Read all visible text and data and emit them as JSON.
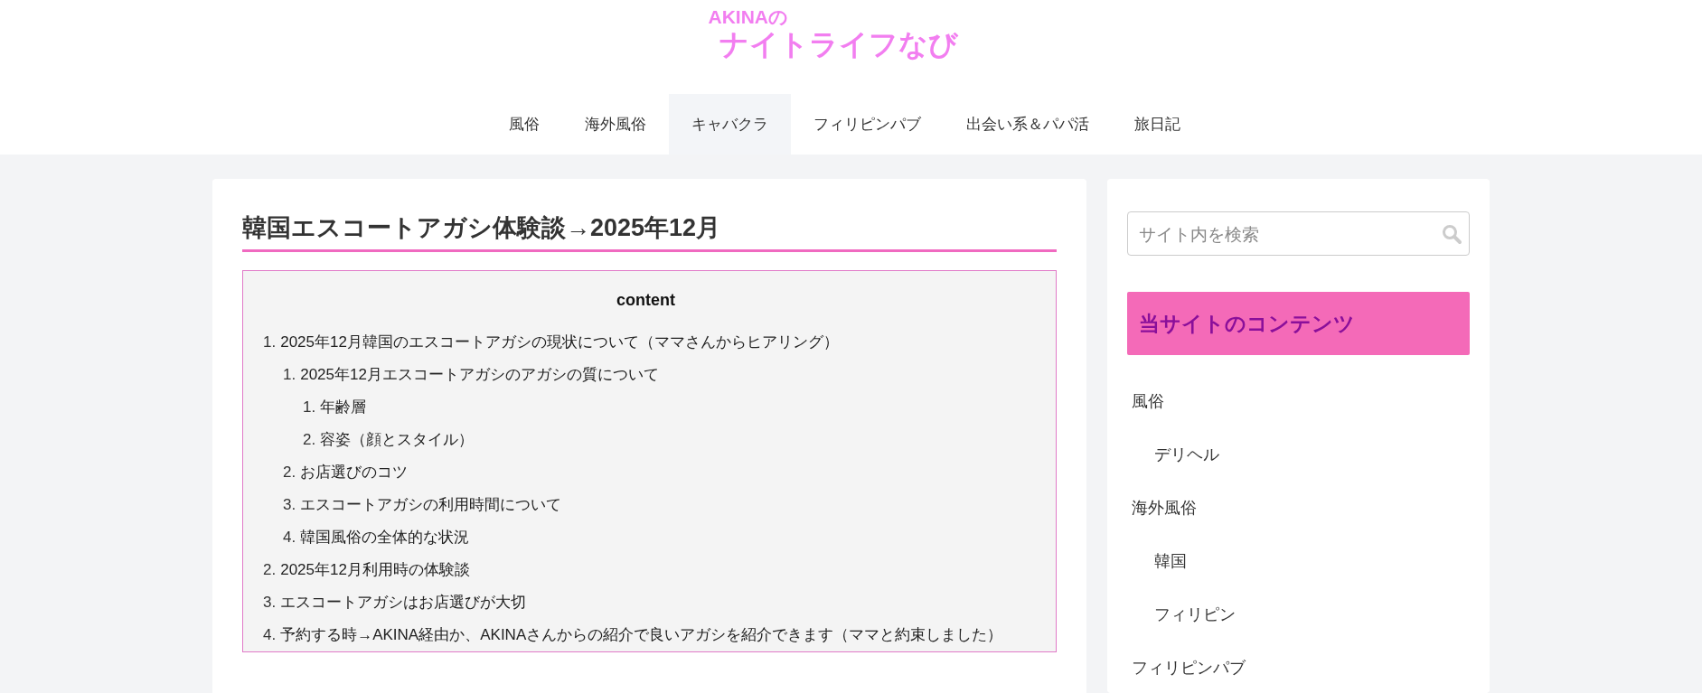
{
  "logo": {
    "line_1": "AKINAの",
    "line_2": "ナイトライフなび"
  },
  "nav": [
    {
      "label": "風俗",
      "selected": false
    },
    {
      "label": "海外風俗",
      "selected": false
    },
    {
      "label": "キャバクラ",
      "selected": true
    },
    {
      "label": "フィリピンパブ",
      "selected": false
    },
    {
      "label": "出会い系＆パパ活",
      "selected": false
    },
    {
      "label": "旅日記",
      "selected": false
    }
  ],
  "article": {
    "title": "韓国エスコートアガシ体験談→2025年12月",
    "toc": {
      "heading": "content",
      "items": [
        {
          "number": "1.",
          "label": "2025年12月韓国のエスコートアガシの現状について（ママさんからヒアリング）",
          "children": [
            {
              "number": "1.",
              "label": "2025年12月エスコートアガシのアガシの質について",
              "children": [
                {
                  "number": "1.",
                  "label": "年齢層"
                },
                {
                  "number": "2.",
                  "label": "容姿（顔とスタイル）"
                }
              ]
            },
            {
              "number": "2.",
              "label": "お店選びのコツ"
            },
            {
              "number": "3.",
              "label": "エスコートアガシの利用時間について"
            },
            {
              "number": "4.",
              "label": "韓国風俗の全体的な状況"
            }
          ]
        },
        {
          "number": "2.",
          "label": "2025年12月利用時の体験談"
        },
        {
          "number": "3.",
          "label": "エスコートアガシはお店選びが大切"
        },
        {
          "number": "4.",
          "label": "予約する時→AKINA経由か、AKINAさんからの紹介で良いアガシを紹介できます（ママと約束しました）"
        }
      ]
    }
  },
  "sidebar": {
    "search": {
      "placeholder": "サイト内を検索"
    },
    "menu_heading": "当サイトのコンテンツ",
    "menu": [
      {
        "label": "風俗",
        "children": [
          {
            "label": "デリヘル"
          }
        ]
      },
      {
        "label": "海外風俗",
        "children": [
          {
            "label": "韓国"
          },
          {
            "label": "フィリピン"
          }
        ]
      },
      {
        "label": "フィリピンパブ"
      }
    ]
  }
}
